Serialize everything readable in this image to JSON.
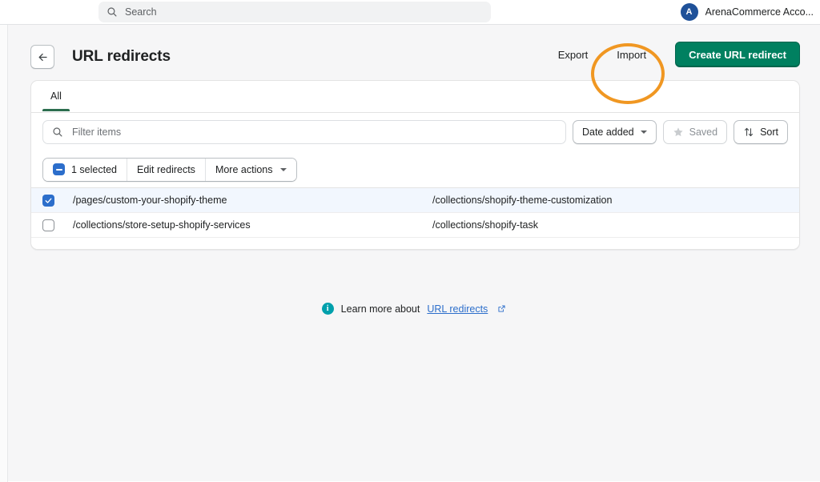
{
  "topbar": {
    "search": {
      "placeholder": "Search",
      "icon": "search-icon"
    },
    "account": {
      "initial": "A",
      "name": "ArenaCommerce Acco...",
      "avatar_color": "#1f5199"
    }
  },
  "page_header": {
    "back_icon": "arrow-left-icon",
    "title": "URL redirects",
    "export_label": "Export",
    "import_label": "Import",
    "create_label": "Create URL redirect",
    "primary_color": "#008060"
  },
  "annotation": {
    "shape": "ellipse",
    "target": "Export",
    "color": "#f09722"
  },
  "card": {
    "tabs": [
      {
        "label": "All",
        "active": true
      }
    ],
    "filter": {
      "placeholder": "Filter items",
      "icon": "search-icon",
      "date_added_label": "Date added",
      "saved_label": "Saved",
      "saved_icon": "star-icon",
      "saved_disabled": true,
      "sort_label": "Sort",
      "sort_icon": "sort-arrows-icon"
    },
    "bulk": {
      "selected_label": "1 selected",
      "checkbox_state": "indeterminate",
      "edit_label": "Edit redirects",
      "more_actions_label": "More actions"
    },
    "table": {
      "rows": [
        {
          "selected": true,
          "from": "/pages/custom-your-shopify-theme",
          "to": "/collections/shopify-theme-customization"
        },
        {
          "selected": false,
          "from": "/collections/store-setup-shopify-services",
          "to": "/collections/shopify-task"
        }
      ]
    }
  },
  "footer": {
    "info_icon": "info-icon",
    "text": "Learn more about",
    "link_label": "URL redirects",
    "external_icon": "external-link-icon"
  }
}
